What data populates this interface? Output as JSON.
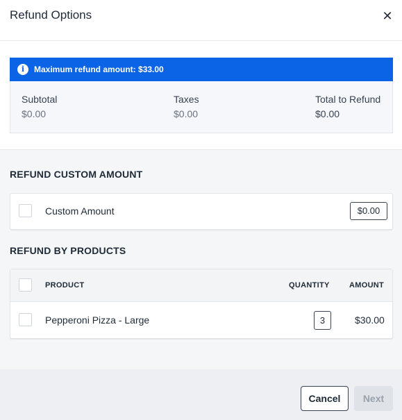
{
  "dialog": {
    "title": "Refund Options",
    "close_icon": "close-icon"
  },
  "banner": {
    "icon": "info-icon",
    "prefix": "Maximum refund amount: ",
    "amount": "$33.00",
    "color": "#0b63e5"
  },
  "totals": {
    "subtotal_label": "Subtotal",
    "subtotal_value": "$0.00",
    "taxes_label": "Taxes",
    "taxes_value": "$0.00",
    "total_label": "Total to Refund",
    "total_value": "$0.00"
  },
  "custom_amount": {
    "heading": "REFUND CUSTOM AMOUNT",
    "label": "Custom Amount",
    "value": "$0.00",
    "checked": false
  },
  "products": {
    "heading": "REFUND BY PRODUCTS",
    "columns": {
      "product": "PRODUCT",
      "quantity": "QUANTITY",
      "amount": "AMOUNT"
    },
    "rows": [
      {
        "name": "Pepperoni Pizza - Large",
        "quantity": "3",
        "amount": "$30.00",
        "checked": false
      }
    ]
  },
  "footer": {
    "cancel_label": "Cancel",
    "next_label": "Next",
    "next_disabled": true
  }
}
